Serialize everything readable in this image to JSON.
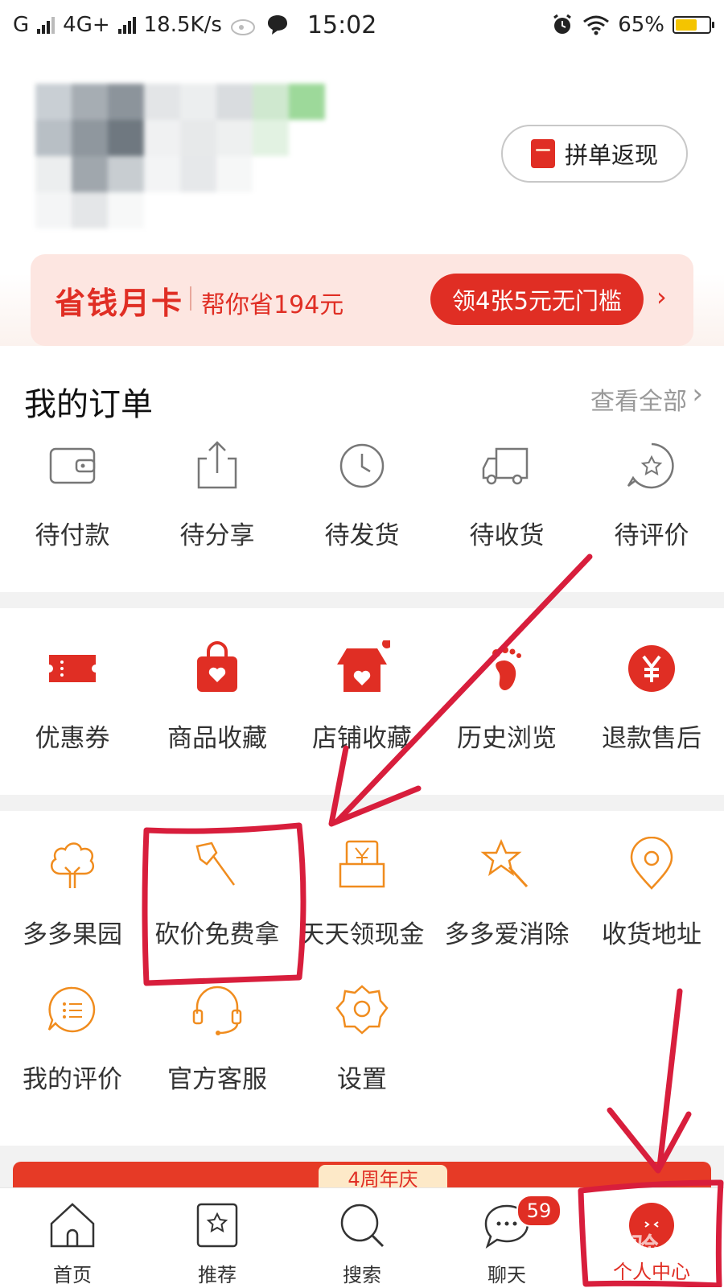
{
  "status_bar": {
    "carrier1": "G",
    "carrier2": "4G+",
    "speed": "18.5K/s",
    "time": "15:02",
    "battery": "65%",
    "battery_level": 0.65
  },
  "header": {
    "refund_label": "拼单返现"
  },
  "savings_card": {
    "title": "省钱月卡",
    "subtitle": "帮你省194元",
    "button": "领4张5元无门槛",
    "arrow": "›"
  },
  "orders": {
    "title": "我的订单",
    "view_all": "查看全部",
    "chevron": "›",
    "items": [
      {
        "label": "待付款",
        "icon": "wallet-icon"
      },
      {
        "label": "待分享",
        "icon": "share-icon"
      },
      {
        "label": "待发货",
        "icon": "clock-icon"
      },
      {
        "label": "待收货",
        "icon": "truck-icon"
      },
      {
        "label": "待评价",
        "icon": "star-review-icon"
      }
    ]
  },
  "quick": {
    "items": [
      {
        "label": "优惠券",
        "icon": "coupon-icon"
      },
      {
        "label": "商品收藏",
        "icon": "bag-heart-icon"
      },
      {
        "label": "店铺收藏",
        "icon": "shop-heart-icon"
      },
      {
        "label": "历史浏览",
        "icon": "footprint-icon"
      },
      {
        "label": "退款售后",
        "icon": "yen-circle-icon"
      }
    ]
  },
  "services": {
    "row1": [
      {
        "label": "多多果园",
        "icon": "tree-icon"
      },
      {
        "label": "砍价免费拿",
        "icon": "axe-icon"
      },
      {
        "label": "天天领现金",
        "icon": "cash-envelope-icon"
      },
      {
        "label": "多多爱消除",
        "icon": "star-wand-icon"
      },
      {
        "label": "收货地址",
        "icon": "location-pin-icon"
      }
    ],
    "row2": [
      {
        "label": "我的评价",
        "icon": "comment-icon"
      },
      {
        "label": "官方客服",
        "icon": "headset-icon"
      },
      {
        "label": "设置",
        "icon": "settings-gear-icon"
      }
    ]
  },
  "banner": {
    "tag": "4周年庆"
  },
  "tabbar": {
    "items": [
      {
        "label": "首页",
        "icon": "home-icon"
      },
      {
        "label": "推荐",
        "icon": "recommend-icon"
      },
      {
        "label": "搜索",
        "icon": "search-icon"
      },
      {
        "label": "聊天",
        "icon": "chat-icon",
        "badge": "59"
      },
      {
        "label": "个人中心",
        "icon": "profile-icon"
      }
    ]
  },
  "watermark": "Bai经验",
  "colors": {
    "brand_red": "#e02e24",
    "service_orange": "#f08c1e",
    "annotation": "#d81e3c"
  }
}
